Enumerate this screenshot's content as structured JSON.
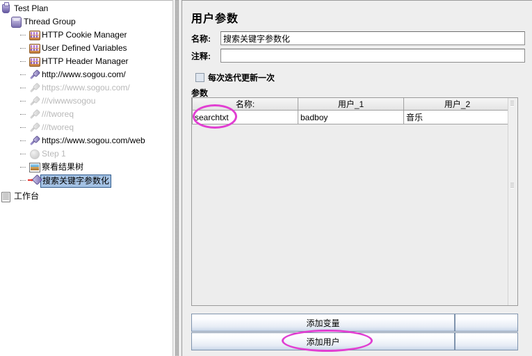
{
  "tree": {
    "nodes": [
      {
        "label": "Test Plan",
        "icon": "test-plan-icon",
        "indent": 0,
        "state": "normal",
        "handle": false
      },
      {
        "label": "Thread Group",
        "icon": "thread-group-icon",
        "indent": 14,
        "state": "normal",
        "handle": false
      },
      {
        "label": "HTTP Cookie Manager",
        "icon": "config-element-icon",
        "indent": 28,
        "state": "normal",
        "handle": true
      },
      {
        "label": "User Defined Variables",
        "icon": "config-element-icon",
        "indent": 28,
        "state": "normal",
        "handle": true
      },
      {
        "label": "HTTP Header Manager",
        "icon": "config-element-icon",
        "indent": 28,
        "state": "normal",
        "handle": true
      },
      {
        "label": "http://www.sogou.com/",
        "icon": "http-sampler-icon",
        "indent": 28,
        "state": "normal",
        "handle": true
      },
      {
        "label": "https://www.sogou.com/",
        "icon": "http-sampler-disabled-icon",
        "indent": 28,
        "state": "disabled",
        "handle": true
      },
      {
        "label": "///viwwwsogou",
        "icon": "http-sampler-disabled-icon",
        "indent": 28,
        "state": "disabled",
        "handle": true
      },
      {
        "label": "///tworeq",
        "icon": "http-sampler-disabled-icon",
        "indent": 28,
        "state": "disabled",
        "handle": true
      },
      {
        "label": "///tworeq",
        "icon": "http-sampler-disabled-icon",
        "indent": 28,
        "state": "disabled",
        "handle": true
      },
      {
        "label": "https://www.sogou.com/web",
        "icon": "http-sampler-icon",
        "indent": 28,
        "state": "normal",
        "handle": true
      },
      {
        "label": "Step 1",
        "icon": "step-disabled-icon",
        "indent": 28,
        "state": "disabled",
        "handle": true
      },
      {
        "label": "察看结果树",
        "icon": "view-results-tree-icon",
        "indent": 28,
        "state": "normal",
        "handle": true
      },
      {
        "label": "搜索关键字参数化",
        "icon": "pre-processor-icon",
        "indent": 28,
        "state": "selected",
        "handle": true
      }
    ],
    "workbench": {
      "label": "工作台",
      "icon": "workbench-icon"
    }
  },
  "panel": {
    "title": "用户参数",
    "name_field": {
      "label": "名称:",
      "value": "搜索关键字参数化",
      "placeholder": ""
    },
    "comment_field": {
      "label": "注释:",
      "value": "",
      "placeholder": ""
    },
    "update_checkbox": {
      "label": "每次迭代更新一次",
      "checked": false
    },
    "params_label": "参数",
    "table": {
      "columns": [
        "名称:",
        "用户_1",
        "用户_2"
      ],
      "rows": [
        [
          "searchtxt",
          "badboy",
          "音乐"
        ]
      ]
    },
    "buttons": {
      "add_variable": "添加变量",
      "add_user": "添加用户",
      "add_variable_secondary": "",
      "add_user_secondary": ""
    }
  },
  "annotations": {
    "color": "#e13fd2",
    "highlights": [
      "searchtxt",
      "添加用户"
    ]
  }
}
